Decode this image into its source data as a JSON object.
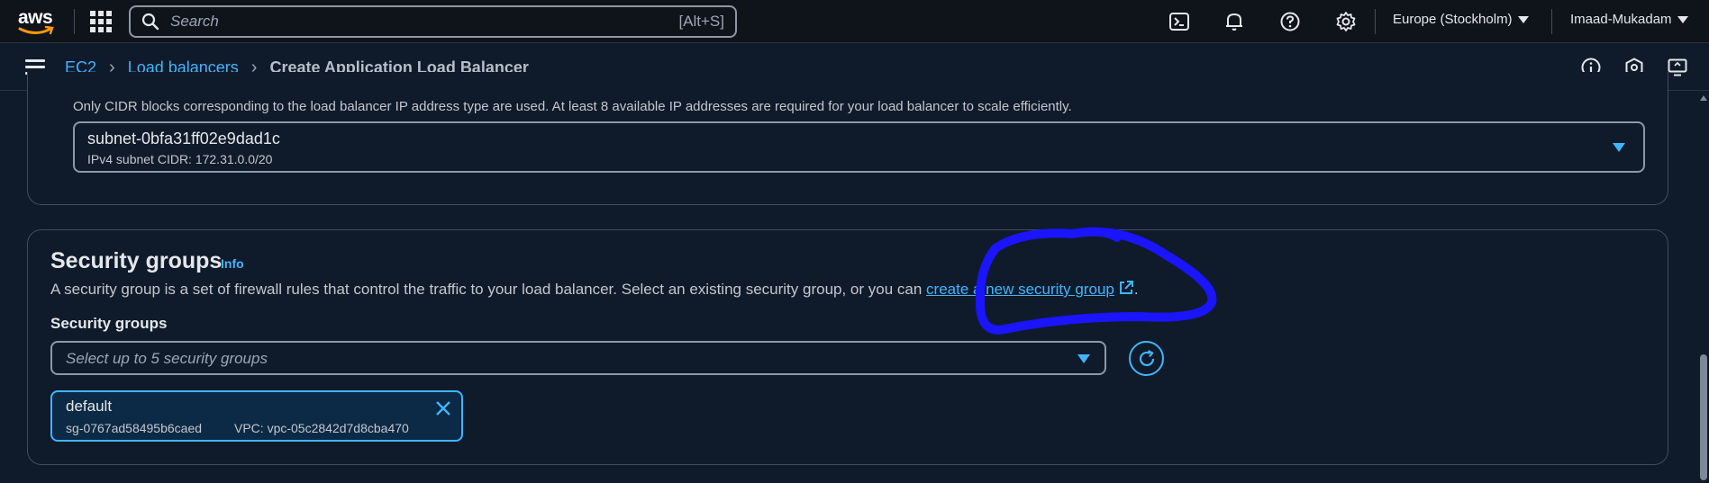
{
  "topbar": {
    "logo_text": "aws",
    "search_placeholder": "Search",
    "search_shortcut": "[Alt+S]",
    "region": "Europe (Stockholm)",
    "user": "Imaad-Mukadam"
  },
  "breadcrumb": {
    "items": [
      "EC2",
      "Load balancers"
    ],
    "current": "Create Application Load Balancer"
  },
  "subnet": {
    "note": "Only CIDR blocks corresponding to the load balancer IP address type are used. At least 8 available IP addresses are required for your load balancer to scale efficiently.",
    "selected_value": "subnet-0bfa31ff02e9dad1c",
    "selected_detail": "IPv4 subnet CIDR: 172.31.0.0/20"
  },
  "security_groups": {
    "title": "Security groups",
    "info_label": "Info",
    "description_prefix": "A security group is a set of firewall rules that control the traffic to your load balancer. Select an existing security group, or you can ",
    "description_link": "create a new security group",
    "description_suffix": ".",
    "field_label": "Security groups",
    "select_placeholder": "Select up to 5 security groups",
    "selected": {
      "name": "default",
      "id": "sg-0767ad58495b6caed",
      "vpc": "VPC: vpc-05c2842d7d8cba470"
    }
  },
  "colors": {
    "link": "#42b4ff",
    "annotation": "#1a14ff",
    "background": "#0f1b2a"
  }
}
